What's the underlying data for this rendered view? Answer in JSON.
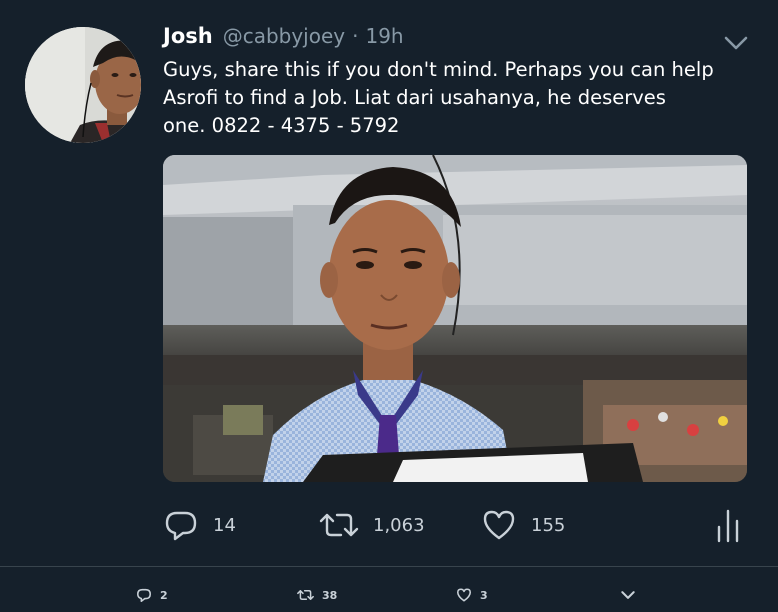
{
  "tweet": {
    "author": {
      "name": "Josh",
      "handle": "@cabbyjoey",
      "separator": "·",
      "time": "19h"
    },
    "text": "Guys, share this if you don't mind. Perhaps you can help\nAsrofi to find a Job. Liat dari usahanya, he deserves\none. 0822 - 4375 - 5792",
    "media": {
      "description_icon": "photo"
    },
    "actions": {
      "replies": "14",
      "retweets": "1,063",
      "likes": "155"
    }
  },
  "bottom_bar": {
    "replies": "2",
    "retweets": "38",
    "likes": "3"
  },
  "colors": {
    "background": "#15202b",
    "secondary_text": "#8899a6",
    "divider": "#38444d"
  },
  "icons": {
    "reply": "reply-icon",
    "retweet": "retweet-icon",
    "like": "heart-icon",
    "analytics": "analytics-icon",
    "chevron": "chevron-down-icon"
  }
}
